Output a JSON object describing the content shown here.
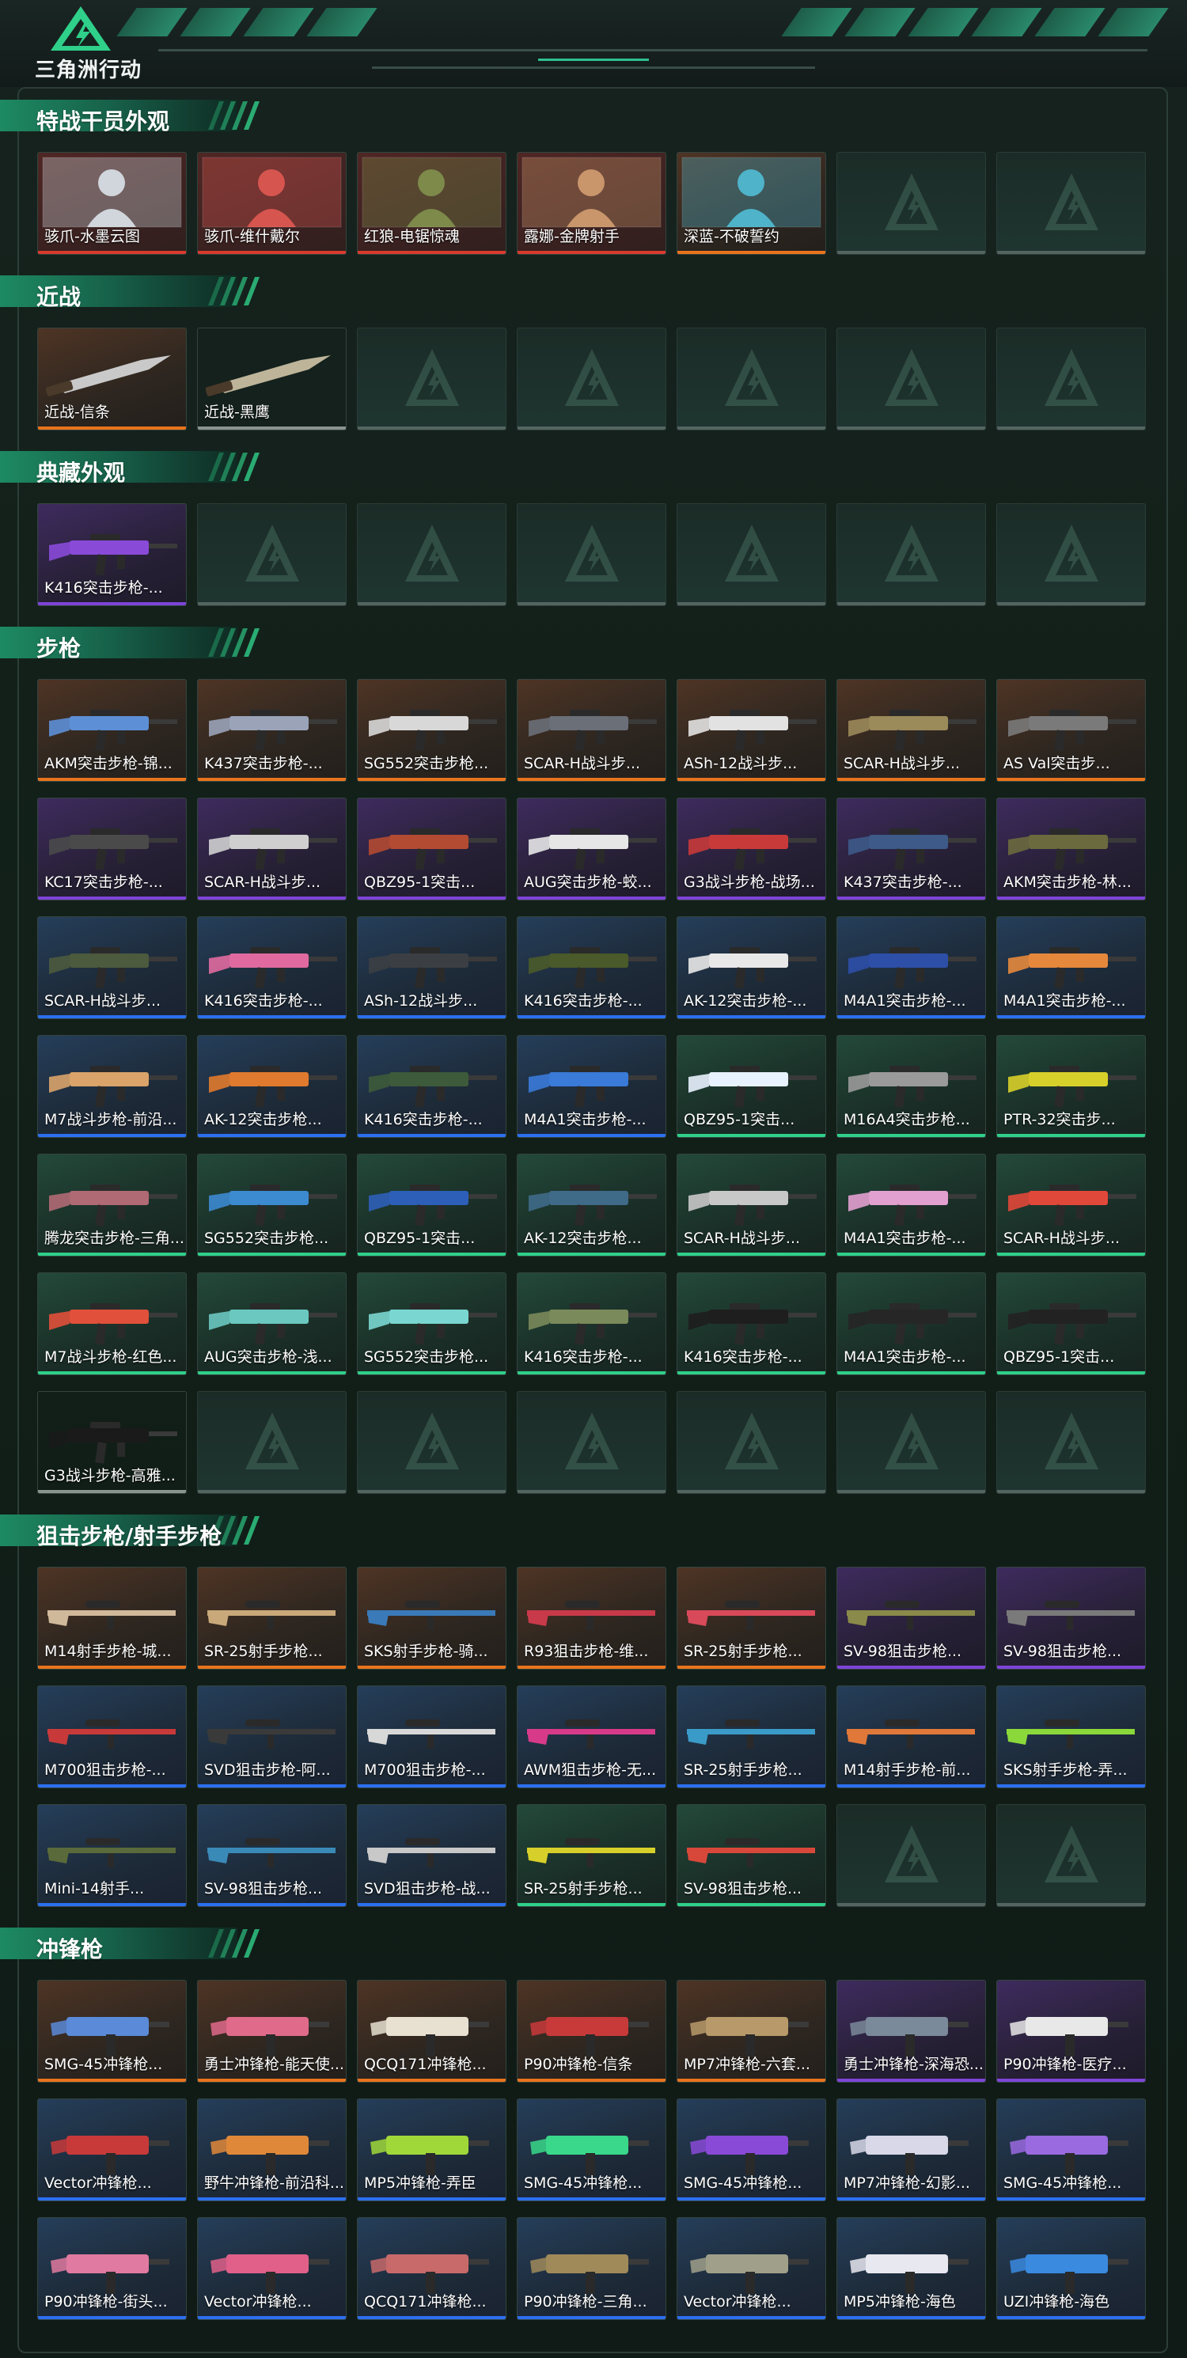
{
  "header": {
    "game_title": "三角洲行动"
  },
  "colors": {
    "orange": "#e9741c",
    "red": "#d83b2d",
    "purple": "#7e44d8",
    "blue": "#2c6ff0",
    "green": "#2fd08a",
    "gray": "#8a9491",
    "accent": "#1d8a63"
  },
  "sections": [
    {
      "title": "特战干员外观",
      "items": [
        {
          "name": "骇爪-水墨云图",
          "rarity": "red",
          "kind": "operator",
          "color": "#d0d6dc"
        },
        {
          "name": "骇爪-维什戴尔",
          "rarity": "red",
          "kind": "operator",
          "color": "#d7554f"
        },
        {
          "name": "红狼-电锯惊魂",
          "rarity": "red",
          "kind": "operator",
          "color": "#7d8a4a"
        },
        {
          "name": "露娜-金牌射手",
          "rarity": "red",
          "kind": "operator",
          "color": "#c9956b"
        },
        {
          "name": "深蓝-不破誓约",
          "rarity": "orange",
          "kind": "operator",
          "color": "#4fb3c9"
        },
        {
          "empty": true
        },
        {
          "empty": true
        }
      ]
    },
    {
      "title": "近战",
      "items": [
        {
          "name": "近战-信条",
          "rarity": "orange",
          "kind": "knife",
          "color": "#c9c9c9"
        },
        {
          "name": "近战-黑鹰",
          "rarity": "gray",
          "kind": "knife",
          "color": "#bdb49a"
        },
        {
          "empty": true
        },
        {
          "empty": true
        },
        {
          "empty": true
        },
        {
          "empty": true
        },
        {
          "empty": true
        }
      ]
    },
    {
      "title": "典藏外观",
      "items": [
        {
          "name": "K416突击步枪-...",
          "rarity": "purple",
          "kind": "rifle",
          "color": "#8a4ad8"
        },
        {
          "empty": true
        },
        {
          "empty": true
        },
        {
          "empty": true
        },
        {
          "empty": true
        },
        {
          "empty": true
        },
        {
          "empty": true
        }
      ]
    },
    {
      "title": "步枪",
      "items": [
        {
          "name": "AKM突击步枪-锦...",
          "rarity": "orange",
          "kind": "rifle",
          "color": "#5d8fd6"
        },
        {
          "name": "K437突击步枪-...",
          "rarity": "orange",
          "kind": "rifle",
          "color": "#9aa3b8"
        },
        {
          "name": "SG552突击步枪...",
          "rarity": "orange",
          "kind": "rifle",
          "color": "#d8d8d8"
        },
        {
          "name": "SCAR-H战斗步...",
          "rarity": "orange",
          "kind": "rifle",
          "color": "#6a6f78"
        },
        {
          "name": "ASh-12战斗步...",
          "rarity": "orange",
          "kind": "rifle",
          "color": "#e2e2e2"
        },
        {
          "name": "SCAR-H战斗步...",
          "rarity": "orange",
          "kind": "rifle",
          "color": "#9b8a5a"
        },
        {
          "name": "AS Val突击步...",
          "rarity": "orange",
          "kind": "rifle",
          "color": "#7a7a7a"
        },
        {
          "name": "KC17突击步枪-...",
          "rarity": "purple",
          "kind": "rifle",
          "color": "#4a4a4a"
        },
        {
          "name": "SCAR-H战斗步...",
          "rarity": "purple",
          "kind": "rifle",
          "color": "#cfcfcf"
        },
        {
          "name": "QBZ95-1突击...",
          "rarity": "purple",
          "kind": "rifle",
          "color": "#b34a32"
        },
        {
          "name": "AUG突击步枪-蛟...",
          "rarity": "purple",
          "kind": "rifle",
          "color": "#e6e6e6"
        },
        {
          "name": "G3战斗步枪-战场...",
          "rarity": "purple",
          "kind": "rifle",
          "color": "#c83a3a"
        },
        {
          "name": "K437突击步枪-...",
          "rarity": "purple",
          "kind": "rifle",
          "color": "#3d5a88"
        },
        {
          "name": "AKM突击步枪-林...",
          "rarity": "purple",
          "kind": "rifle",
          "color": "#6b6a3e"
        },
        {
          "name": "SCAR-H战斗步...",
          "rarity": "blue",
          "kind": "rifle",
          "color": "#4c5a3e"
        },
        {
          "name": "K416突击步枪-...",
          "rarity": "blue",
          "kind": "rifle",
          "color": "#e06aa0"
        },
        {
          "name": "ASh-12战斗步...",
          "rarity": "blue",
          "kind": "rifle",
          "color": "#3b3f43"
        },
        {
          "name": "K416突击步枪-...",
          "rarity": "blue",
          "kind": "rifle",
          "color": "#4a5a2a"
        },
        {
          "name": "AK-12突击步枪-...",
          "rarity": "blue",
          "kind": "rifle",
          "color": "#e8e8e8"
        },
        {
          "name": "M4A1突击步枪-...",
          "rarity": "blue",
          "kind": "rifle",
          "color": "#2d4fa8"
        },
        {
          "name": "M4A1突击步枪-...",
          "rarity": "blue",
          "kind": "rifle",
          "color": "#e6883c"
        },
        {
          "name": "M7战斗步枪-前沿...",
          "rarity": "blue",
          "kind": "rifle",
          "color": "#d9a36a"
        },
        {
          "name": "AK-12突击步枪...",
          "rarity": "blue",
          "kind": "rifle",
          "color": "#e07a2e"
        },
        {
          "name": "K416突击步枪-...",
          "rarity": "blue",
          "kind": "rifle",
          "color": "#3d5a3a"
        },
        {
          "name": "M4A1突击步枪-...",
          "rarity": "blue",
          "kind": "rifle",
          "color": "#3a7ad8"
        },
        {
          "name": "QBZ95-1突击...",
          "rarity": "green",
          "kind": "rifle",
          "color": "#e8f2ff"
        },
        {
          "name": "M16A4突击步枪...",
          "rarity": "green",
          "kind": "rifle",
          "color": "#9a9a9a"
        },
        {
          "name": "PTR-32突击步...",
          "rarity": "green",
          "kind": "rifle",
          "color": "#d8d02a"
        },
        {
          "name": "腾龙突击步枪-三角...",
          "rarity": "green",
          "kind": "rifle",
          "color": "#b06a74"
        },
        {
          "name": "SG552突击步枪...",
          "rarity": "green",
          "kind": "rifle",
          "color": "#3c8ad0"
        },
        {
          "name": "QBZ95-1突击...",
          "rarity": "green",
          "kind": "rifle",
          "color": "#2d5fb8"
        },
        {
          "name": "AK-12突击步枪...",
          "rarity": "green",
          "kind": "rifle",
          "color": "#3f6a88"
        },
        {
          "name": "SCAR-H战斗步...",
          "rarity": "green",
          "kind": "rifle",
          "color": "#c8c8c8"
        },
        {
          "name": "M4A1突击步枪-...",
          "rarity": "green",
          "kind": "rifle",
          "color": "#e2a0d0"
        },
        {
          "name": "SCAR-H战斗步...",
          "rarity": "green",
          "kind": "rifle",
          "color": "#e0483a"
        },
        {
          "name": "M7战斗步枪-红色...",
          "rarity": "green",
          "kind": "rifle",
          "color": "#e0503a"
        },
        {
          "name": "AUG突击步枪-浅...",
          "rarity": "green",
          "kind": "rifle",
          "color": "#6ac8c0"
        },
        {
          "name": "SG552突击步枪...",
          "rarity": "green",
          "kind": "rifle",
          "color": "#7ad6d0"
        },
        {
          "name": "K416突击步枪-...",
          "rarity": "green",
          "kind": "rifle",
          "color": "#7a8a5a"
        },
        {
          "name": "K416突击步枪-...",
          "rarity": "green",
          "kind": "rifle",
          "color": "#1e1e1e"
        },
        {
          "name": "M4A1突击步枪-...",
          "rarity": "green",
          "kind": "rifle",
          "color": "#262626"
        },
        {
          "name": "QBZ95-1突击...",
          "rarity": "green",
          "kind": "rifle",
          "color": "#222222"
        },
        {
          "name": "G3战斗步枪-高雅...",
          "rarity": "gray",
          "kind": "rifle",
          "color": "#1a1a1a"
        },
        {
          "empty": true
        },
        {
          "empty": true
        },
        {
          "empty": true
        },
        {
          "empty": true
        },
        {
          "empty": true
        },
        {
          "empty": true
        }
      ]
    },
    {
      "title": "狙击步枪/射手步枪",
      "items": [
        {
          "name": "M14射手步枪-城...",
          "rarity": "orange",
          "kind": "sniper",
          "color": "#d0b89a"
        },
        {
          "name": "SR-25射手步枪...",
          "rarity": "orange",
          "kind": "sniper",
          "color": "#c9a87a"
        },
        {
          "name": "SKS射手步枪-骑...",
          "rarity": "orange",
          "kind": "sniper",
          "color": "#3a7ab8"
        },
        {
          "name": "R93狙击步枪-维...",
          "rarity": "orange",
          "kind": "sniper",
          "color": "#c83a4a"
        },
        {
          "name": "SR-25射手步枪...",
          "rarity": "orange",
          "kind": "sniper",
          "color": "#d84a5a"
        },
        {
          "name": "SV-98狙击步枪...",
          "rarity": "purple",
          "kind": "sniper",
          "color": "#8a8a4a"
        },
        {
          "name": "SV-98狙击步枪...",
          "rarity": "purple",
          "kind": "sniper",
          "color": "#7a7a7a"
        },
        {
          "name": "M700狙击步枪-...",
          "rarity": "blue",
          "kind": "sniper",
          "color": "#c83a3a"
        },
        {
          "name": "SVD狙击步枪-阿...",
          "rarity": "blue",
          "kind": "sniper",
          "color": "#3a3a3a"
        },
        {
          "name": "M700狙击步枪-...",
          "rarity": "blue",
          "kind": "sniper",
          "color": "#d8d8d8"
        },
        {
          "name": "AWM狙击步枪-无...",
          "rarity": "blue",
          "kind": "sniper",
          "color": "#d83a8a"
        },
        {
          "name": "SR-25射手步枪...",
          "rarity": "blue",
          "kind": "sniper",
          "color": "#3a9ac8"
        },
        {
          "name": "M14射手步枪-前...",
          "rarity": "blue",
          "kind": "sniper",
          "color": "#e0783a"
        },
        {
          "name": "SKS射手步枪-弄...",
          "rarity": "blue",
          "kind": "sniper",
          "color": "#8ad83a"
        },
        {
          "name": "Mini-14射手...",
          "rarity": "blue",
          "kind": "sniper",
          "color": "#5a6a3a"
        },
        {
          "name": "SV-98狙击步枪...",
          "rarity": "blue",
          "kind": "sniper",
          "color": "#3a8ab8"
        },
        {
          "name": "SVD狙击步枪-战...",
          "rarity": "blue",
          "kind": "sniper",
          "color": "#c8c8c8"
        },
        {
          "name": "SR-25射手步枪...",
          "rarity": "green",
          "kind": "sniper",
          "color": "#d8d02a"
        },
        {
          "name": "SV-98狙击步枪...",
          "rarity": "green",
          "kind": "sniper",
          "color": "#d8483a"
        },
        {
          "empty": true
        },
        {
          "empty": true
        }
      ]
    },
    {
      "title": "冲锋枪",
      "items": [
        {
          "name": "SMG-45冲锋枪...",
          "rarity": "orange",
          "kind": "smg",
          "color": "#5a8ad8"
        },
        {
          "name": "勇士冲锋枪-能天使...",
          "rarity": "orange",
          "kind": "smg",
          "color": "#e06a8a"
        },
        {
          "name": "QCQ171冲锋枪...",
          "rarity": "orange",
          "kind": "smg",
          "color": "#e8e0d0"
        },
        {
          "name": "P90冲锋枪-信条",
          "rarity": "orange",
          "kind": "smg",
          "color": "#c83a3a"
        },
        {
          "name": "MP7冲锋枪-六套...",
          "rarity": "orange",
          "kind": "smg",
          "color": "#b89a6a"
        },
        {
          "name": "勇士冲锋枪-深海恐...",
          "rarity": "purple",
          "kind": "smg",
          "color": "#7a8a9a"
        },
        {
          "name": "P90冲锋枪-医疗...",
          "rarity": "purple",
          "kind": "smg",
          "color": "#e8e8e8"
        },
        {
          "name": "Vector冲锋枪...",
          "rarity": "blue",
          "kind": "smg",
          "color": "#c83a3a"
        },
        {
          "name": "野牛冲锋枪-前沿科...",
          "rarity": "blue",
          "kind": "smg",
          "color": "#e0883a"
        },
        {
          "name": "MP5冲锋枪-弄臣",
          "rarity": "blue",
          "kind": "smg",
          "color": "#a0d83a"
        },
        {
          "name": "SMG-45冲锋枪...",
          "rarity": "blue",
          "kind": "smg",
          "color": "#3ad88a"
        },
        {
          "name": "SMG-45冲锋枪...",
          "rarity": "blue",
          "kind": "smg",
          "color": "#8a4ad8"
        },
        {
          "name": "MP7冲锋枪-幻影...",
          "rarity": "blue",
          "kind": "smg",
          "color": "#d8d8e8"
        },
        {
          "name": "SMG-45冲锋枪...",
          "rarity": "blue",
          "kind": "smg",
          "color": "#9a6ae0"
        },
        {
          "name": "P90冲锋枪-街头...",
          "rarity": "blue",
          "kind": "smg",
          "color": "#e07aa0"
        },
        {
          "name": "Vector冲锋枪...",
          "rarity": "blue",
          "kind": "smg",
          "color": "#e0608a"
        },
        {
          "name": "QCQ171冲锋枪...",
          "rarity": "blue",
          "kind": "smg",
          "color": "#c86a6a"
        },
        {
          "name": "P90冲锋枪-三角...",
          "rarity": "blue",
          "kind": "smg",
          "color": "#a08a5a"
        },
        {
          "name": "Vector冲锋枪...",
          "rarity": "blue",
          "kind": "smg",
          "color": "#a0a08a"
        },
        {
          "name": "MP5冲锋枪-海色",
          "rarity": "blue",
          "kind": "smg",
          "color": "#e8e8f0"
        },
        {
          "name": "UZI冲锋枪-海色",
          "rarity": "blue",
          "kind": "smg",
          "color": "#3a8ae0"
        }
      ]
    }
  ]
}
